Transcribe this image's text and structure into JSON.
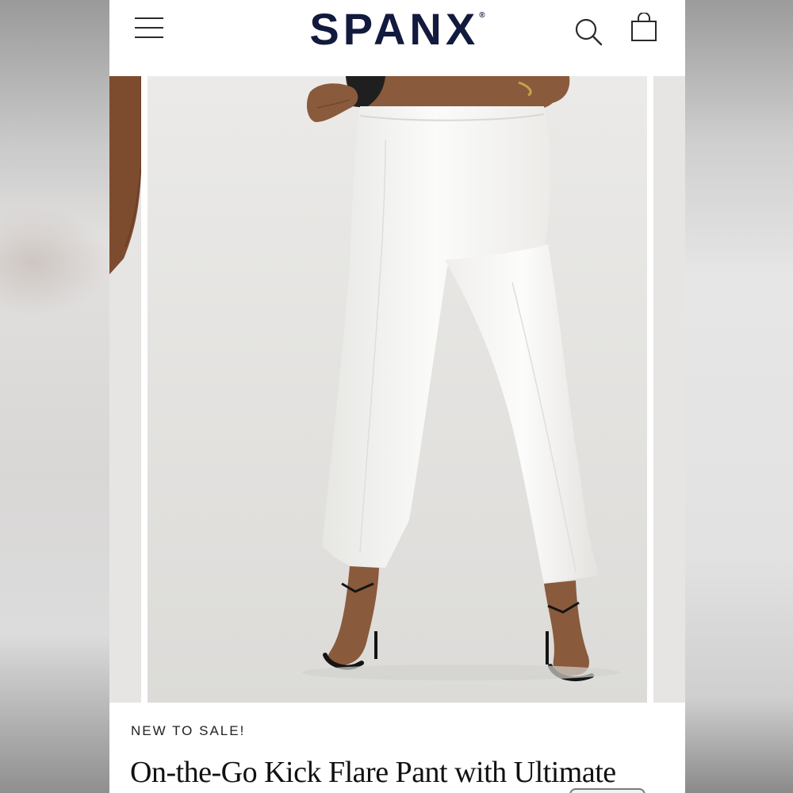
{
  "header": {
    "brand": "SPANX",
    "brand_mark": "®",
    "menu_icon": "hamburger-menu-icon",
    "search_icon": "search-icon",
    "cart_icon": "shopping-bag-icon"
  },
  "product": {
    "badge": "NEW TO SALE!",
    "title": "On-the-Go Kick Flare Pant with Ultimate"
  },
  "colors": {
    "brand_navy": "#121a3d",
    "pant_white": "#f7f7f5",
    "photo_background": "#e9e8e6",
    "skin": "#8a5a3c"
  }
}
